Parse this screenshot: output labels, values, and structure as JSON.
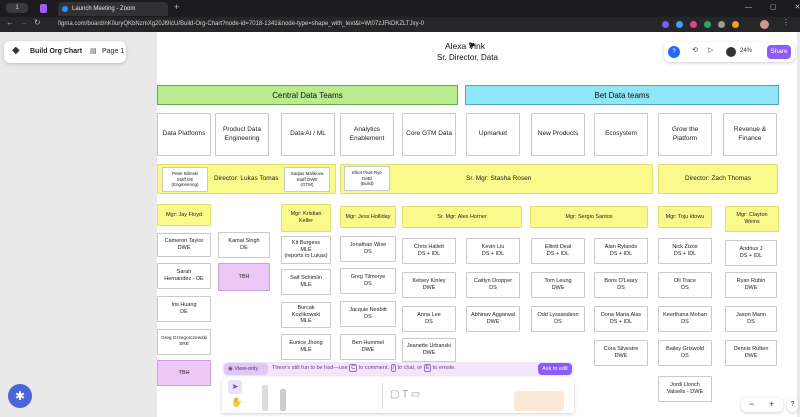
{
  "browser": {
    "tab_badge": "1",
    "tab_title": "Launch Meeting - Zoom",
    "url": "figma.com/board/nK0uryQKbNzmXg20Jl9IcU/Build-Org-Chart?node-id=7018-1341&node-type=shape_with_text&t=Wt07zJFkDKZLTJxy-0"
  },
  "figma": {
    "file_name": "Build Org Chart",
    "page_name": "Page 1",
    "share_label": "Share",
    "user_badge": "?",
    "zoom": "24%",
    "zoom_out": "−",
    "zoom_in": "+",
    "help": "?",
    "view_only_label": "View-only",
    "banner_text": "There's still fun to be had—use",
    "banner_key_c": "C",
    "banner_mid1": "to comment,",
    "banner_key_slash": "/",
    "banner_mid2": "to chat, or",
    "banner_key_e": "E",
    "banner_end": "to emote.",
    "ask_edit": "Ask to edit"
  },
  "org": {
    "top_name": "Alexa Vink",
    "top_title": "Sr. Director, Data",
    "central": "Central Data Teams",
    "bet": "Bet Data teams",
    "depts": [
      "Data Platforms",
      "Product Data\nEngineering",
      "Data AI / ML",
      "Analytics\nEnablement",
      "Core GTM Data",
      "Upmarket",
      "New Products",
      "Ecosystem",
      "Grow the\nPlatform",
      "Revenue &\nFinance"
    ],
    "staff1": "Peter Bilinski\nStaff DE\n(Engineering)",
    "dir_lukas": "Director: Lukas Tomas",
    "staff2": "Sadjas Malikova\nStaff DWE\n(GTM)",
    "staff3": "Elliot Pant-Rye\nDeBl\n(Build)",
    "mgr_stasha": "Sr. Mgr: Stasha Rosen",
    "dir_zach": "Director: Zach Thomas",
    "managers": [
      "Mgr: Jay Floyd",
      "Mgr: Kristian\nKeller",
      "Mgr: Jess Holliday",
      "Sr. Mgr: Alex Horner",
      "Mgr: Sergio Santos",
      "Mgr: Toju Idowu",
      "Mgr: Clayton\nWeins"
    ],
    "c1": [
      "Cameron Taylor\nDWE",
      "Sarah\nHernandez - DE",
      "Iris Huang\nDE",
      "Greg Grzegorczewski\nSRE"
    ],
    "tbh": "TBH",
    "c2_first": "Kamal Singh\nDE",
    "c3": [
      "Kit Burgess\nMLE\n(reports to Lukas)",
      "Saif Schimlin\nMLE",
      "Burcak Kozlikowski\nMLE",
      "Eunice Jhong\nMLE"
    ],
    "c4": [
      "Jonathan Wise\nDS",
      "Greg Tilmorye\nDS",
      "Jacquie Nesbitt\nDS",
      "Ben Hummel\nDWE"
    ],
    "c5": [
      "Chris Hallett\nDS + IDL",
      "Kelsey Kinley\nDWE",
      "Anna Lee\nDS",
      "Jeanette Urbanski\nDWE"
    ],
    "c6": [
      "Kevin Liu\nDS + IDL",
      "Caitlyn Dropper\nDS",
      "Abhinav Aggarwal\nDWE"
    ],
    "c7": [
      "Elliott Deal\nDS + IDL",
      "Tom Leung\nDWE",
      "Odd Lyssandson\nDS"
    ],
    "c8": [
      "Alan Rylands\nDS + IDL",
      "Boris O'Leary\nDS",
      "Dona Maria Alas\nDS + IDL",
      "Cora Silvestre\nDWE"
    ],
    "c9": [
      "Nick Zizos\nDS + IDL",
      "Oli Trace\nDS",
      "Keerthana Mohan\nDS",
      "Bailey Griswold\nDS",
      "Jordi Llonch\nValsells - DWE"
    ],
    "c10": [
      "Andrius J\nDS + IDL",
      "Ryan Rubin\nDWE",
      "Jason Mann\nDS",
      "Dennis Rutten\nDWE"
    ]
  }
}
